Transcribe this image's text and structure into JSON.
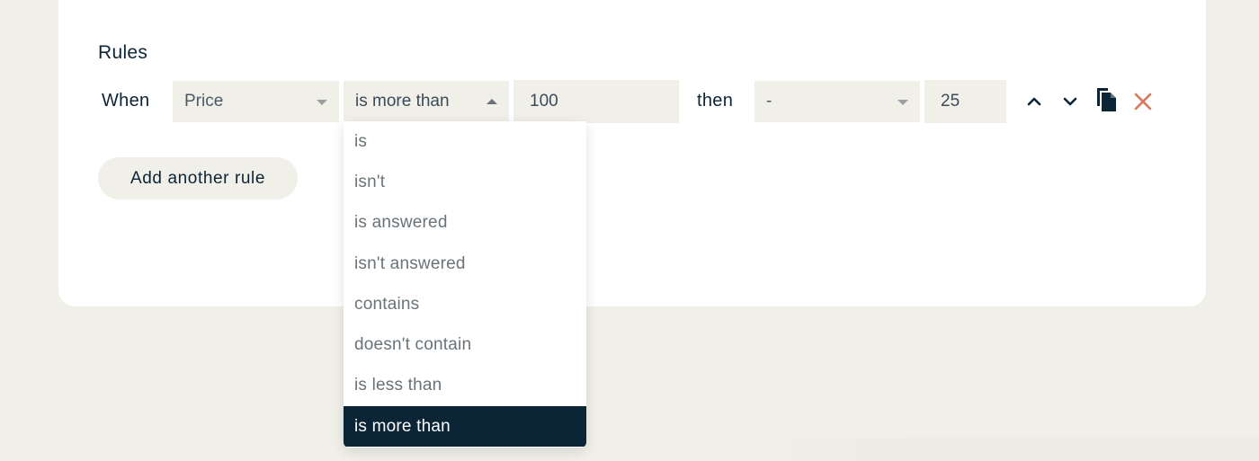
{
  "section": {
    "title": "Rules"
  },
  "rule": {
    "when_label": "When",
    "field": "Price",
    "operator": "is more than",
    "value": "100",
    "then_label": "then",
    "action": "-",
    "amount": "25"
  },
  "add_rule_label": "Add another rule",
  "dropdown": {
    "options": [
      "is",
      "isn't",
      "is answered",
      "isn't answered",
      "contains",
      "doesn't contain",
      "is less than",
      "is more than"
    ],
    "selected_index": 7
  },
  "colors": {
    "background": "#f0efe8",
    "card": "#ffffff",
    "text": "#0b2536",
    "selected_bg": "#0b2536",
    "delete": "#d9785a"
  },
  "icons": [
    "chevron-up-icon",
    "chevron-down-icon",
    "duplicate-icon",
    "close-icon"
  ]
}
